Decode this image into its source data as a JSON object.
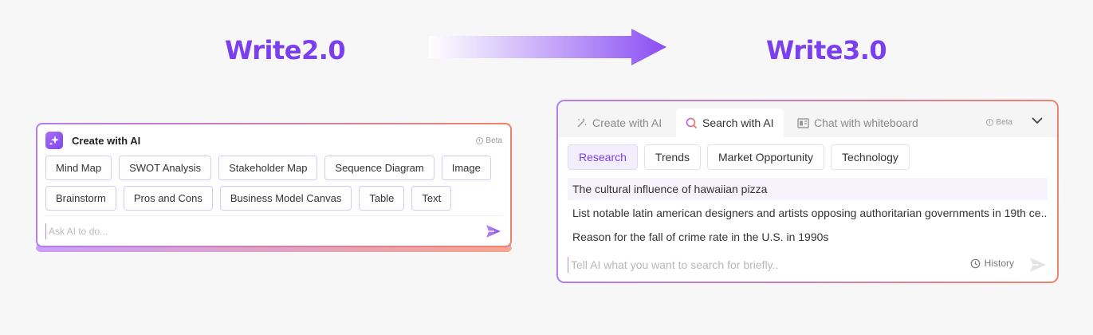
{
  "headings": {
    "left": "Write2.0",
    "right": "Write3.0"
  },
  "write2": {
    "title": "Create with AI",
    "beta": "Beta",
    "chips_row1": [
      "Mind Map",
      "SWOT Analysis",
      "Stakeholder Map",
      "Sequence Diagram",
      "Image"
    ],
    "chips_row2": [
      "Brainstorm",
      "Pros and Cons",
      "Business Model Canvas",
      "Table",
      "Text"
    ],
    "input_placeholder": "Ask AI to do..."
  },
  "write3": {
    "tabs": [
      "Create with AI",
      "Search with AI",
      "Chat with whiteboard"
    ],
    "active_tab": "Search with AI",
    "beta": "Beta",
    "pills": [
      "Research",
      "Trends",
      "Market Opportunity",
      "Technology"
    ],
    "active_pill": "Research",
    "suggestions": [
      "The cultural influence of hawaiian pizza",
      "List notable latin american designers and artists opposing authoritarian governments in 19th ce..",
      "Reason for the fall of crime rate in the U.S. in 1990s"
    ],
    "input_placeholder": "Tell AI what you want to search for briefly..",
    "history_label": "History"
  },
  "colors": {
    "accent": "#7b3ff0",
    "gradient_start": "#b27cf3",
    "gradient_end": "#f2826b"
  },
  "icons": [
    "sparkle-icon",
    "info-icon",
    "send-icon",
    "magic-wand-icon",
    "search-icon",
    "whiteboard-icon",
    "chevron-down-icon",
    "history-icon",
    "arrow-right-icon"
  ]
}
